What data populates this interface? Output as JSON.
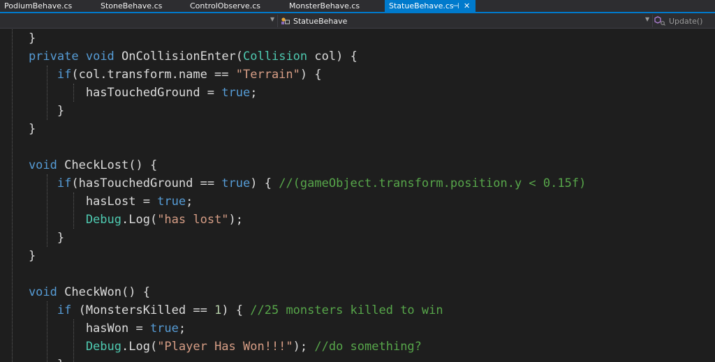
{
  "tabs": [
    {
      "label": "PodiumBehave.cs",
      "active": false
    },
    {
      "label": "StoneBehave.cs",
      "active": false
    },
    {
      "label": "ControlObserve.cs",
      "active": false
    },
    {
      "label": "MonsterBehave.cs",
      "active": false
    },
    {
      "label": "StatueBehave.cs",
      "active": true
    }
  ],
  "tab_pin_glyph": "⊣",
  "tab_close_glyph": "✕",
  "navbar": {
    "class_name": "StatueBehave",
    "member_name": "Update()",
    "class_icon": "class-icon",
    "member_icon": "method-icon"
  },
  "code_lines": [
    [
      [
        "pl",
        "    }"
      ]
    ],
    [
      [
        "kw",
        "    private"
      ],
      [
        "pl",
        " "
      ],
      [
        "kw",
        "void"
      ],
      [
        "pl",
        " OnCollisionEnter("
      ],
      [
        "type",
        "Collision"
      ],
      [
        "pl",
        " col) {"
      ]
    ],
    [
      [
        "kw",
        "        if"
      ],
      [
        "pl",
        "(col.transform.name == "
      ],
      [
        "str",
        "\"Terrain\""
      ],
      [
        "pl",
        ") {"
      ]
    ],
    [
      [
        "pl",
        "            hasTouchedGround = "
      ],
      [
        "kw",
        "true"
      ],
      [
        "pl",
        ";"
      ]
    ],
    [
      [
        "pl",
        "        }"
      ]
    ],
    [
      [
        "pl",
        "    }"
      ]
    ],
    [
      [
        "pl",
        ""
      ]
    ],
    [
      [
        "kw",
        "    void"
      ],
      [
        "pl",
        " CheckLost() {"
      ]
    ],
    [
      [
        "kw",
        "        if"
      ],
      [
        "pl",
        "(hasTouchedGround == "
      ],
      [
        "kw",
        "true"
      ],
      [
        "pl",
        ") { "
      ],
      [
        "cm",
        "//(gameObject.transform.position.y < 0.15f)"
      ]
    ],
    [
      [
        "pl",
        "            hasLost = "
      ],
      [
        "kw",
        "true"
      ],
      [
        "pl",
        ";"
      ]
    ],
    [
      [
        "type",
        "            Debug"
      ],
      [
        "pl",
        ".Log("
      ],
      [
        "str",
        "\"has lost\""
      ],
      [
        "pl",
        ");"
      ]
    ],
    [
      [
        "pl",
        "        }"
      ]
    ],
    [
      [
        "pl",
        "    }"
      ]
    ],
    [
      [
        "pl",
        ""
      ]
    ],
    [
      [
        "kw",
        "    void"
      ],
      [
        "pl",
        " CheckWon() {"
      ]
    ],
    [
      [
        "kw",
        "        if"
      ],
      [
        "pl",
        " (MonstersKilled == "
      ],
      [
        "num",
        "1"
      ],
      [
        "pl",
        ") { "
      ],
      [
        "cm",
        "//25 monsters killed to win"
      ]
    ],
    [
      [
        "pl",
        "            hasWon = "
      ],
      [
        "kw",
        "true"
      ],
      [
        "pl",
        ";"
      ]
    ],
    [
      [
        "type",
        "            Debug"
      ],
      [
        "pl",
        ".Log("
      ],
      [
        "str",
        "\"Player Has Won!!!\""
      ],
      [
        "pl",
        "); "
      ],
      [
        "cm",
        "//do something?"
      ]
    ],
    [
      [
        "pl",
        "        }"
      ]
    ]
  ],
  "colors": {
    "background": "#1e1e1e",
    "accent": "#007acc",
    "keyword": "#569cd6",
    "type": "#4ec9b0",
    "string": "#d69d85",
    "number": "#b5cea8",
    "comment": "#57a64a",
    "text": "#dcdcdc"
  }
}
